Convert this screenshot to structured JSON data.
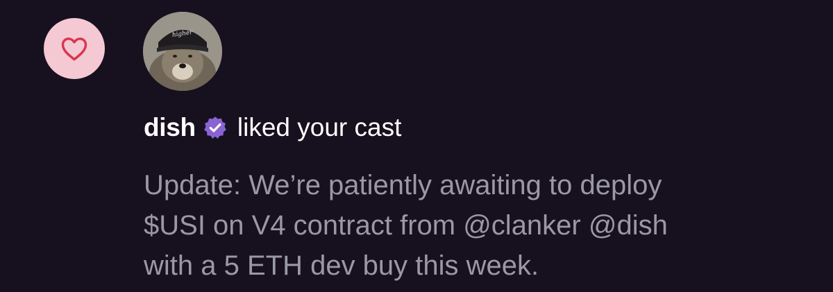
{
  "notification": {
    "type_icon": "heart-icon",
    "avatar_icon": "wolf-avatar-icon",
    "username": "dish",
    "verified_icon": "verified-badge-icon",
    "action_text": "liked your cast",
    "cast_text": "Update: We’re patiently awaiting to deploy\n$USI on V4 contract from @clanker @dish\nwith a 5 ETH dev buy this week.",
    "avatar_cap_text": "higher"
  },
  "colors": {
    "background": "#17101f",
    "like_badge_bg": "#f5c9d3",
    "heart_stroke": "#d9374e",
    "verified_purple": "#8a63d2",
    "username_text": "#ffffff",
    "cast_text": "#9b98a6"
  }
}
